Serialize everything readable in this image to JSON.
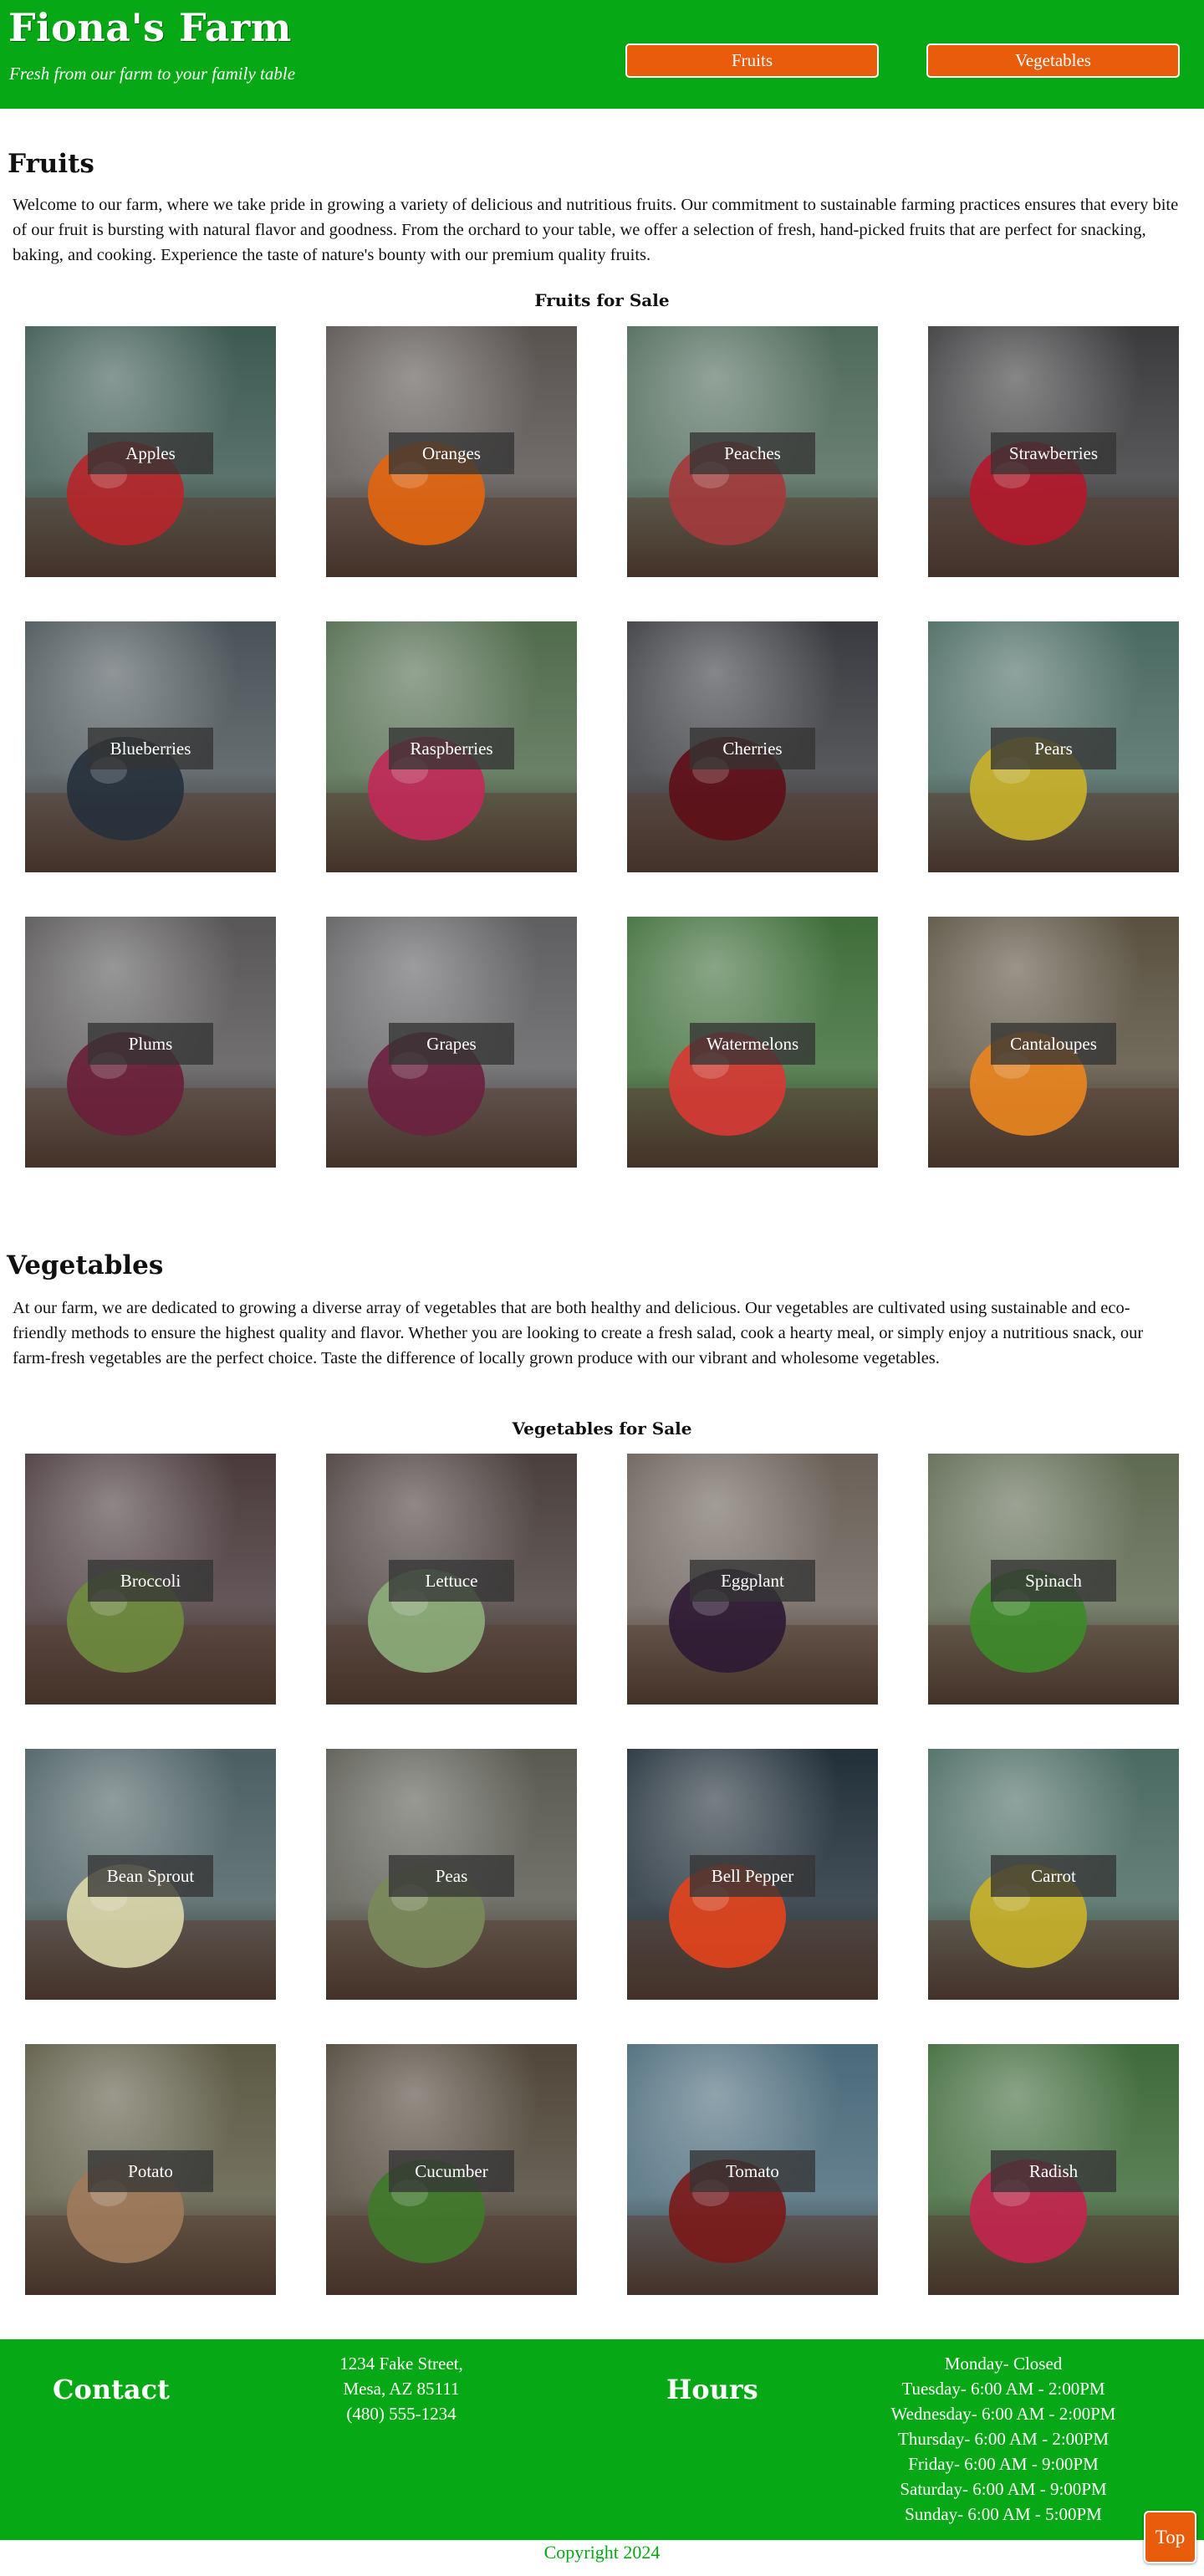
{
  "theme": {
    "brand_green": "#07a815",
    "accent_orange": "#e85c0b",
    "tile_label_bg": "#343434"
  },
  "header": {
    "title": "Fiona's Farm",
    "tagline": "Fresh from our farm to your family table",
    "nav": [
      {
        "label": "Fruits"
      },
      {
        "label": "Vegetables"
      }
    ]
  },
  "fruits": {
    "heading": "Fruits",
    "intro": "Welcome to our farm, where we take pride in growing a variety of delicious and nutritious fruits. Our commitment to sustainable farming practices ensures that every bite of our fruit is bursting with natural flavor and goodness. From the orchard to your table, we offer a selection of fresh, hand-picked fruits that are perfect for snacking, baking, and cooking. Experience the taste of nature's bounty with our premium quality fruits.",
    "subheading": "Fruits for Sale",
    "items": [
      {
        "label": "Apples",
        "bg": "#3d5a52",
        "fg": "#b5262a"
      },
      {
        "label": "Oranges",
        "bg": "#595350",
        "fg": "#e2650f"
      },
      {
        "label": "Peaches",
        "bg": "#4f6a5a",
        "fg": "#a33b3c"
      },
      {
        "label": "Strawberries",
        "bg": "#3b3b3d",
        "fg": "#b3192b"
      },
      {
        "label": "Blueberries",
        "bg": "#4a5458",
        "fg": "#26313c"
      },
      {
        "label": "Raspberries",
        "bg": "#516b4d",
        "fg": "#c02a58"
      },
      {
        "label": "Cherries",
        "bg": "#3a3b40",
        "fg": "#5e0f18"
      },
      {
        "label": "Pears",
        "bg": "#4a6a62",
        "fg": "#c8b12a"
      },
      {
        "label": "Plums",
        "bg": "#585657",
        "fg": "#6a1f3a"
      },
      {
        "label": "Grapes",
        "bg": "#5f5f62",
        "fg": "#6b2240"
      },
      {
        "label": "Watermelons",
        "bg": "#3f6e3a",
        "fg": "#d63a34"
      },
      {
        "label": "Cantaloupes",
        "bg": "#5a5140",
        "fg": "#e8841f"
      }
    ]
  },
  "vegetables": {
    "heading": "Vegetables",
    "intro": "At our farm, we are dedicated to growing a diverse array of vegetables that are both healthy and delicious. Our vegetables are cultivated using sustainable and eco-friendly methods to ensure the highest quality and flavor. Whether you are looking to create a fresh salad, cook a hearty meal, or simply enjoy a nutritious snack, our farm-fresh vegetables are the perfect choice. Taste the difference of locally grown produce with our vibrant and wholesome vegetables.",
    "subheading": "Vegetables for Sale",
    "items": [
      {
        "label": "Broccoli",
        "bg": "#4a3a3c",
        "fg": "#6e8a3e"
      },
      {
        "label": "Lettuce",
        "bg": "#4a3f3d",
        "fg": "#8cad7a"
      },
      {
        "label": "Eggplant",
        "bg": "#6a6058",
        "fg": "#2e1a34"
      },
      {
        "label": "Spinach",
        "bg": "#5f6a52",
        "fg": "#3d8a2a"
      },
      {
        "label": "Bean Sprout",
        "bg": "#4b5f62",
        "fg": "#d9d6a8"
      },
      {
        "label": "Peas",
        "bg": "#5a5a52",
        "fg": "#7a8a5a"
      },
      {
        "label": "Bell Pepper",
        "bg": "#22303a",
        "fg": "#e2431c"
      },
      {
        "label": "Carrot",
        "bg": "#4a6a62",
        "fg": "#c8b12a"
      },
      {
        "label": "Potato",
        "bg": "#5c5a44",
        "fg": "#a07a5a"
      },
      {
        "label": "Cucumber",
        "bg": "#504639",
        "fg": "#3f7a2a"
      },
      {
        "label": "Tomato",
        "bg": "#4a6a7a",
        "fg": "#7a1a1a"
      },
      {
        "label": "Radish",
        "bg": "#3f6a3a",
        "fg": "#c2254e"
      }
    ]
  },
  "footer": {
    "contact_heading": "Contact",
    "address_lines": [
      "1234 Fake Street,",
      "Mesa, AZ 85111",
      "(480) 555-1234"
    ],
    "hours_heading": "Hours",
    "hours_lines": [
      "Monday- Closed",
      "Tuesday- 6:00 AM - 2:00PM",
      "Wednesday- 6:00 AM - 2:00PM",
      "Thursday- 6:00 AM - 2:00PM",
      "Friday- 6:00 AM - 9:00PM",
      "Saturday- 6:00 AM - 9:00PM",
      "Sunday- 6:00 AM - 5:00PM"
    ],
    "copyright": "Copyright 2024",
    "top_button": "Top"
  }
}
